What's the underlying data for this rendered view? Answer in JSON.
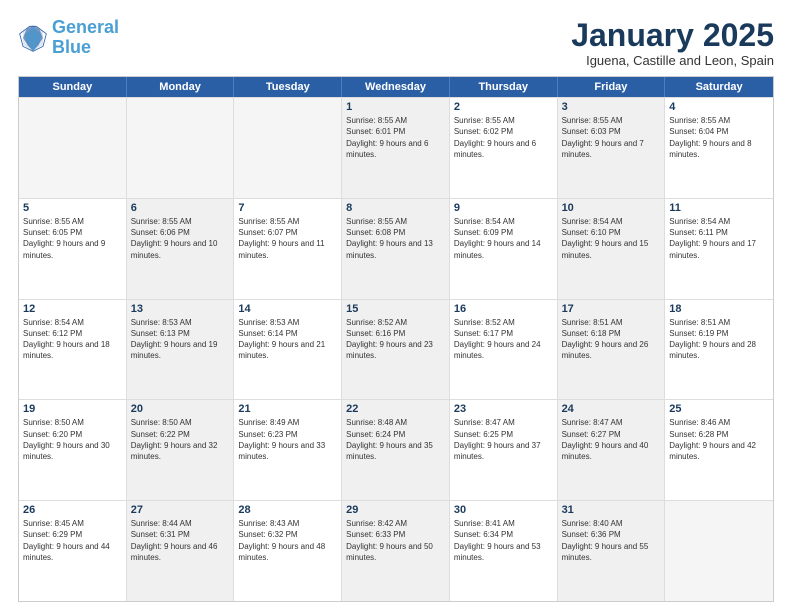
{
  "logo": {
    "line1": "General",
    "line2": "Blue"
  },
  "title": "January 2025",
  "subtitle": "Iguena, Castille and Leon, Spain",
  "weekdays": [
    "Sunday",
    "Monday",
    "Tuesday",
    "Wednesday",
    "Thursday",
    "Friday",
    "Saturday"
  ],
  "rows": [
    [
      {
        "day": "",
        "sunrise": "",
        "sunset": "",
        "daylight": "",
        "shaded": false,
        "empty": true
      },
      {
        "day": "",
        "sunrise": "",
        "sunset": "",
        "daylight": "",
        "shaded": false,
        "empty": true
      },
      {
        "day": "",
        "sunrise": "",
        "sunset": "",
        "daylight": "",
        "shaded": false,
        "empty": true
      },
      {
        "day": "1",
        "sunrise": "Sunrise: 8:55 AM",
        "sunset": "Sunset: 6:01 PM",
        "daylight": "Daylight: 9 hours and 6 minutes.",
        "shaded": true,
        "empty": false
      },
      {
        "day": "2",
        "sunrise": "Sunrise: 8:55 AM",
        "sunset": "Sunset: 6:02 PM",
        "daylight": "Daylight: 9 hours and 6 minutes.",
        "shaded": false,
        "empty": false
      },
      {
        "day": "3",
        "sunrise": "Sunrise: 8:55 AM",
        "sunset": "Sunset: 6:03 PM",
        "daylight": "Daylight: 9 hours and 7 minutes.",
        "shaded": true,
        "empty": false
      },
      {
        "day": "4",
        "sunrise": "Sunrise: 8:55 AM",
        "sunset": "Sunset: 6:04 PM",
        "daylight": "Daylight: 9 hours and 8 minutes.",
        "shaded": false,
        "empty": false
      }
    ],
    [
      {
        "day": "5",
        "sunrise": "Sunrise: 8:55 AM",
        "sunset": "Sunset: 6:05 PM",
        "daylight": "Daylight: 9 hours and 9 minutes.",
        "shaded": false,
        "empty": false
      },
      {
        "day": "6",
        "sunrise": "Sunrise: 8:55 AM",
        "sunset": "Sunset: 6:06 PM",
        "daylight": "Daylight: 9 hours and 10 minutes.",
        "shaded": true,
        "empty": false
      },
      {
        "day": "7",
        "sunrise": "Sunrise: 8:55 AM",
        "sunset": "Sunset: 6:07 PM",
        "daylight": "Daylight: 9 hours and 11 minutes.",
        "shaded": false,
        "empty": false
      },
      {
        "day": "8",
        "sunrise": "Sunrise: 8:55 AM",
        "sunset": "Sunset: 6:08 PM",
        "daylight": "Daylight: 9 hours and 13 minutes.",
        "shaded": true,
        "empty": false
      },
      {
        "day": "9",
        "sunrise": "Sunrise: 8:54 AM",
        "sunset": "Sunset: 6:09 PM",
        "daylight": "Daylight: 9 hours and 14 minutes.",
        "shaded": false,
        "empty": false
      },
      {
        "day": "10",
        "sunrise": "Sunrise: 8:54 AM",
        "sunset": "Sunset: 6:10 PM",
        "daylight": "Daylight: 9 hours and 15 minutes.",
        "shaded": true,
        "empty": false
      },
      {
        "day": "11",
        "sunrise": "Sunrise: 8:54 AM",
        "sunset": "Sunset: 6:11 PM",
        "daylight": "Daylight: 9 hours and 17 minutes.",
        "shaded": false,
        "empty": false
      }
    ],
    [
      {
        "day": "12",
        "sunrise": "Sunrise: 8:54 AM",
        "sunset": "Sunset: 6:12 PM",
        "daylight": "Daylight: 9 hours and 18 minutes.",
        "shaded": false,
        "empty": false
      },
      {
        "day": "13",
        "sunrise": "Sunrise: 8:53 AM",
        "sunset": "Sunset: 6:13 PM",
        "daylight": "Daylight: 9 hours and 19 minutes.",
        "shaded": true,
        "empty": false
      },
      {
        "day": "14",
        "sunrise": "Sunrise: 8:53 AM",
        "sunset": "Sunset: 6:14 PM",
        "daylight": "Daylight: 9 hours and 21 minutes.",
        "shaded": false,
        "empty": false
      },
      {
        "day": "15",
        "sunrise": "Sunrise: 8:52 AM",
        "sunset": "Sunset: 6:16 PM",
        "daylight": "Daylight: 9 hours and 23 minutes.",
        "shaded": true,
        "empty": false
      },
      {
        "day": "16",
        "sunrise": "Sunrise: 8:52 AM",
        "sunset": "Sunset: 6:17 PM",
        "daylight": "Daylight: 9 hours and 24 minutes.",
        "shaded": false,
        "empty": false
      },
      {
        "day": "17",
        "sunrise": "Sunrise: 8:51 AM",
        "sunset": "Sunset: 6:18 PM",
        "daylight": "Daylight: 9 hours and 26 minutes.",
        "shaded": true,
        "empty": false
      },
      {
        "day": "18",
        "sunrise": "Sunrise: 8:51 AM",
        "sunset": "Sunset: 6:19 PM",
        "daylight": "Daylight: 9 hours and 28 minutes.",
        "shaded": false,
        "empty": false
      }
    ],
    [
      {
        "day": "19",
        "sunrise": "Sunrise: 8:50 AM",
        "sunset": "Sunset: 6:20 PM",
        "daylight": "Daylight: 9 hours and 30 minutes.",
        "shaded": false,
        "empty": false
      },
      {
        "day": "20",
        "sunrise": "Sunrise: 8:50 AM",
        "sunset": "Sunset: 6:22 PM",
        "daylight": "Daylight: 9 hours and 32 minutes.",
        "shaded": true,
        "empty": false
      },
      {
        "day": "21",
        "sunrise": "Sunrise: 8:49 AM",
        "sunset": "Sunset: 6:23 PM",
        "daylight": "Daylight: 9 hours and 33 minutes.",
        "shaded": false,
        "empty": false
      },
      {
        "day": "22",
        "sunrise": "Sunrise: 8:48 AM",
        "sunset": "Sunset: 6:24 PM",
        "daylight": "Daylight: 9 hours and 35 minutes.",
        "shaded": true,
        "empty": false
      },
      {
        "day": "23",
        "sunrise": "Sunrise: 8:47 AM",
        "sunset": "Sunset: 6:25 PM",
        "daylight": "Daylight: 9 hours and 37 minutes.",
        "shaded": false,
        "empty": false
      },
      {
        "day": "24",
        "sunrise": "Sunrise: 8:47 AM",
        "sunset": "Sunset: 6:27 PM",
        "daylight": "Daylight: 9 hours and 40 minutes.",
        "shaded": true,
        "empty": false
      },
      {
        "day": "25",
        "sunrise": "Sunrise: 8:46 AM",
        "sunset": "Sunset: 6:28 PM",
        "daylight": "Daylight: 9 hours and 42 minutes.",
        "shaded": false,
        "empty": false
      }
    ],
    [
      {
        "day": "26",
        "sunrise": "Sunrise: 8:45 AM",
        "sunset": "Sunset: 6:29 PM",
        "daylight": "Daylight: 9 hours and 44 minutes.",
        "shaded": false,
        "empty": false
      },
      {
        "day": "27",
        "sunrise": "Sunrise: 8:44 AM",
        "sunset": "Sunset: 6:31 PM",
        "daylight": "Daylight: 9 hours and 46 minutes.",
        "shaded": true,
        "empty": false
      },
      {
        "day": "28",
        "sunrise": "Sunrise: 8:43 AM",
        "sunset": "Sunset: 6:32 PM",
        "daylight": "Daylight: 9 hours and 48 minutes.",
        "shaded": false,
        "empty": false
      },
      {
        "day": "29",
        "sunrise": "Sunrise: 8:42 AM",
        "sunset": "Sunset: 6:33 PM",
        "daylight": "Daylight: 9 hours and 50 minutes.",
        "shaded": true,
        "empty": false
      },
      {
        "day": "30",
        "sunrise": "Sunrise: 8:41 AM",
        "sunset": "Sunset: 6:34 PM",
        "daylight": "Daylight: 9 hours and 53 minutes.",
        "shaded": false,
        "empty": false
      },
      {
        "day": "31",
        "sunrise": "Sunrise: 8:40 AM",
        "sunset": "Sunset: 6:36 PM",
        "daylight": "Daylight: 9 hours and 55 minutes.",
        "shaded": true,
        "empty": false
      },
      {
        "day": "",
        "sunrise": "",
        "sunset": "",
        "daylight": "",
        "shaded": false,
        "empty": true
      }
    ]
  ]
}
